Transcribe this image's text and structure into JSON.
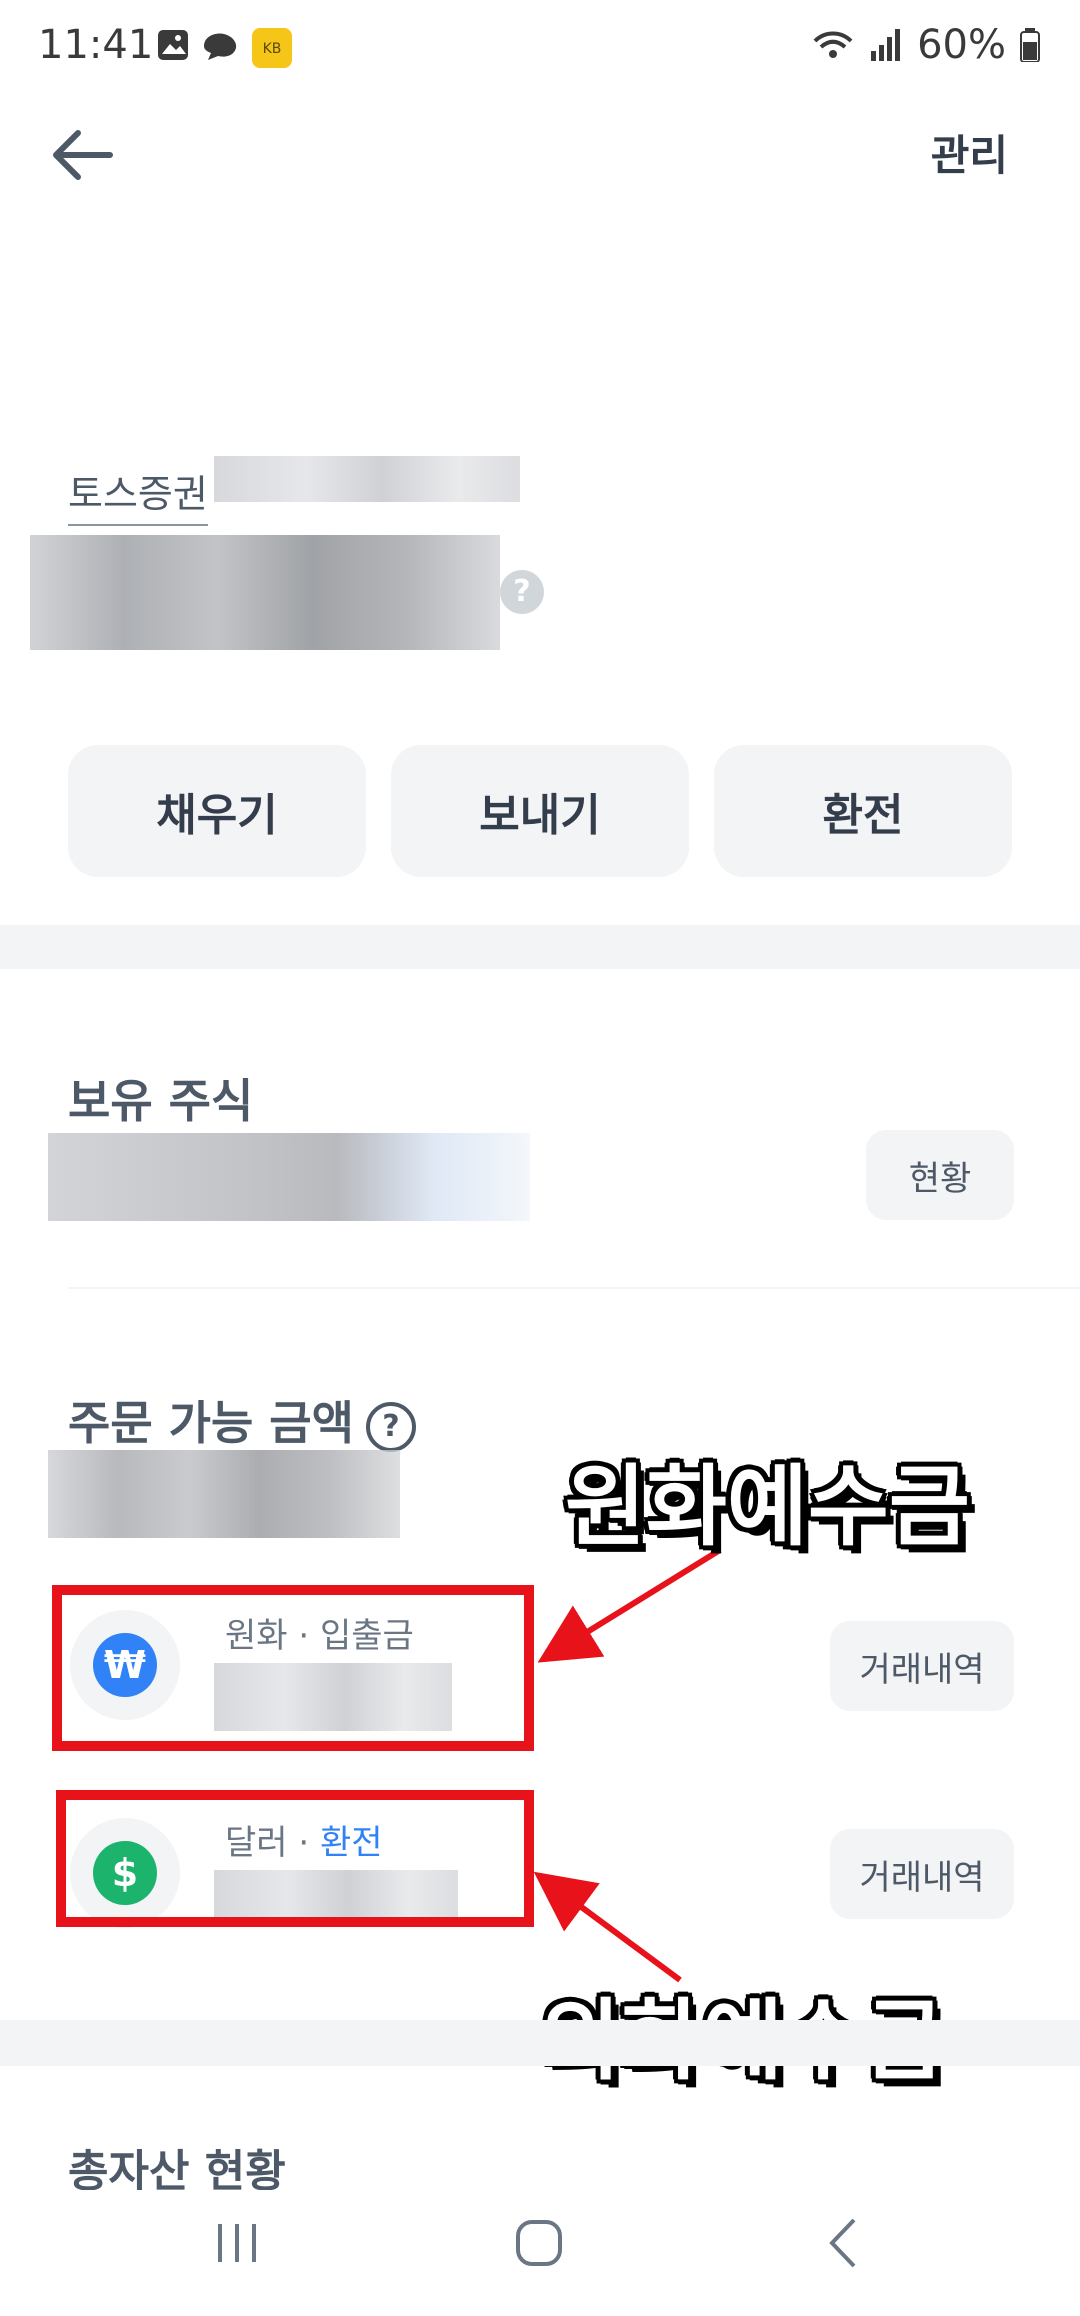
{
  "status_bar": {
    "time": "11:41",
    "battery": "60%"
  },
  "header": {
    "manage_label": "관리"
  },
  "account": {
    "name": "토스증권"
  },
  "actions": {
    "fill": "채우기",
    "send": "보내기",
    "exchange": "환전"
  },
  "holdings": {
    "title": "보유 주식",
    "status_button": "현황"
  },
  "orderable": {
    "title": "주문 가능 금액",
    "help": "?",
    "krw": {
      "label_prefix": "원화 · ",
      "label_link": "입출금",
      "history_button": "거래내역",
      "icon": "won-icon"
    },
    "usd": {
      "label_prefix": "달러 · ",
      "label_link": "환전",
      "history_button": "거래내역",
      "icon": "dollar-icon"
    }
  },
  "annotations": {
    "krw_deposit": "원화예수금",
    "foreign_deposit": "외화예수금"
  },
  "next_section": {
    "title": "총자산 현황"
  },
  "colors": {
    "accent": "#3182f6",
    "won_coin": "#3182f6",
    "dollar_coin": "#1cb36d",
    "annotation_box": "#e8121b"
  }
}
